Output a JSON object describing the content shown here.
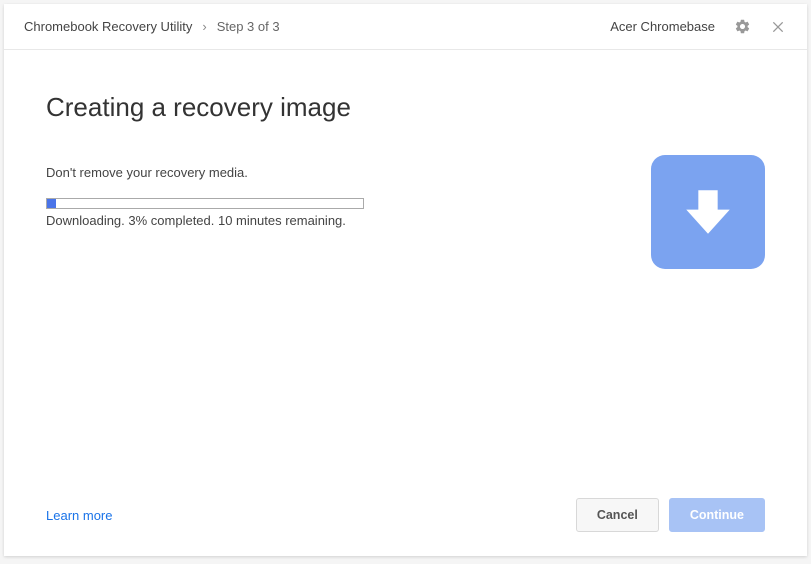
{
  "header": {
    "app_title": "Chromebook Recovery Utility",
    "breadcrumb_separator": "›",
    "step_label": "Step 3 of 3",
    "device_label": "Acer Chromebase"
  },
  "main": {
    "title": "Creating a recovery image",
    "instruction": "Don't remove your recovery media.",
    "progress_text": "Downloading. 3% completed. 10 minutes remaining."
  },
  "footer": {
    "learn_more": "Learn more",
    "cancel": "Cancel",
    "continue": "Continue"
  }
}
